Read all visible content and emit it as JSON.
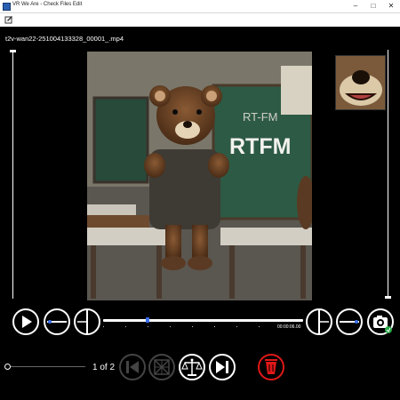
{
  "window": {
    "title": "VR We Are - Check Files Edit"
  },
  "file": {
    "name": "t2v-wan22-251004133328_00001_.mp4"
  },
  "player": {
    "timecode": "00:00:06.00",
    "progress_fraction": 0.22
  },
  "pager": {
    "label": "1 of 2"
  },
  "video_frame": {
    "board_text_1": "RT-FM",
    "board_text_2": "RTFM"
  },
  "icons": {
    "app": "app-icon",
    "menu": "file-edit-icon",
    "play": "play-icon",
    "prev_record": "prev-record-icon",
    "next_record": "next-record-icon",
    "snapshot": "camera-icon",
    "prev_page": "previous-icon",
    "grid": "grid-icon",
    "balance": "balance-icon",
    "next_page": "next-icon",
    "delete": "delete-icon"
  },
  "colors": {
    "accent": "#3a6ff0",
    "delete": "#e01818"
  }
}
